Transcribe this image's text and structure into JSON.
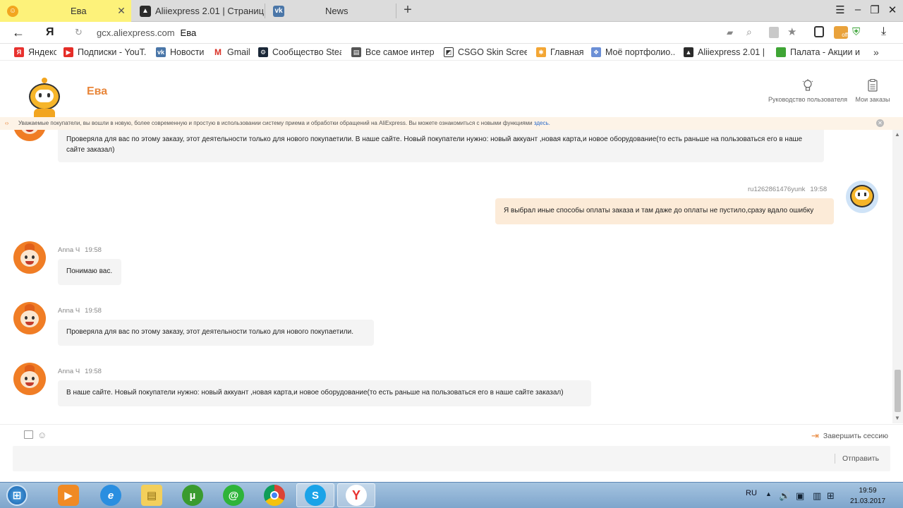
{
  "browser": {
    "tabs": [
      {
        "title": "Ева",
        "active": true,
        "icon": "aliexpress-avatar-icon"
      },
      {
        "title": "Aliiexpress 2.01 | Страница ...",
        "active": false,
        "icon": "batman-icon"
      },
      {
        "title": "News",
        "active": false,
        "icon": "vk-icon"
      }
    ],
    "url_host": "gcx.aliexpress.com",
    "url_title": "Ева",
    "bookmarks": [
      {
        "label": "Яндекс",
        "icon": "yandex-icon",
        "color": "#e8322f"
      },
      {
        "label": "Подписки - YouT...",
        "icon": "youtube-icon",
        "color": "#e52d27"
      },
      {
        "label": "Новости",
        "icon": "vk-icon",
        "color": "#4a76a8"
      },
      {
        "label": "Gmail",
        "icon": "gmail-icon",
        "color": "#d93025"
      },
      {
        "label": "Сообщество Stea...",
        "icon": "steam-icon",
        "color": "#1b2838"
      },
      {
        "label": "Все самое интере...",
        "icon": "page-icon",
        "color": "#555555"
      },
      {
        "label": "CSGO Skin Screen...",
        "icon": "screenshot-icon",
        "color": "#333333"
      },
      {
        "label": "Главная",
        "icon": "joomla-icon",
        "color": "#f3a634"
      },
      {
        "label": "Моё портфолио...",
        "icon": "portfolio-icon",
        "color": "#6b8fd6"
      },
      {
        "label": "Aliiexpress 2.01 | ...",
        "icon": "batman-icon",
        "color": "#2b2b2b"
      },
      {
        "label": "Палата - Акции и ...",
        "icon": "green-square-icon",
        "color": "#3fa535"
      }
    ]
  },
  "header": {
    "agent_name": "Ева",
    "user_guide": "Руководство пользователя",
    "my_orders": "Мои заказы"
  },
  "notice": {
    "text": "Уважаемые покупатели, вы вошли в новую, более современную и простую в использовании систему приема и обработки обращений на AliExpress. Вы можете ознакомиться с новыми функциями",
    "link": "здесь."
  },
  "messages": [
    {
      "author": "",
      "time": "",
      "text": "Проверяла для вас по этому заказу, этот деятельности только для нового покупаетили. В наше сайте. Новый покупатели нужно: новый аккуант ,новая карта,и новое оборудование(то есть раньше на пользоваться его в наше сайте заказал)"
    },
    {
      "author": "ru1262861476yunk",
      "time": "19:58",
      "text": "Я выбрал иные способы оплаты заказа и там даже до оплаты не пустило,сразу вдало ошибку"
    },
    {
      "author": "Anna Ч",
      "time": "19:58",
      "text": "Понимаю вас."
    },
    {
      "author": "Anna Ч",
      "time": "19:58",
      "text": "Проверяла для вас по этому заказу, этот деятельности только для нового покупаетили."
    },
    {
      "author": "Anna Ч",
      "time": "19:58",
      "text": "В наше сайте. Новый покупатели нужно: новый аккуант ,новая карта,и новое оборудование(то есть раньше на пользоваться его в наше сайте заказал)"
    }
  ],
  "composer": {
    "end_session": "Завершить сессию",
    "send": "Отправить"
  },
  "taskbar": {
    "apps": [
      "windows-start-icon",
      "media-player-icon",
      "internet-explorer-icon",
      "file-explorer-icon",
      "utorrent-icon",
      "mail-agent-icon",
      "chrome-icon",
      "skype-icon",
      "yandex-browser-icon"
    ],
    "lang": "RU",
    "time": "19:59",
    "date": "21.03.2017"
  },
  "colors": {
    "active_tab": "#fdf27a",
    "agent_accent": "#e8863a",
    "my_bubble": "#fcebd8",
    "agent_bubble": "#f4f4f4"
  }
}
